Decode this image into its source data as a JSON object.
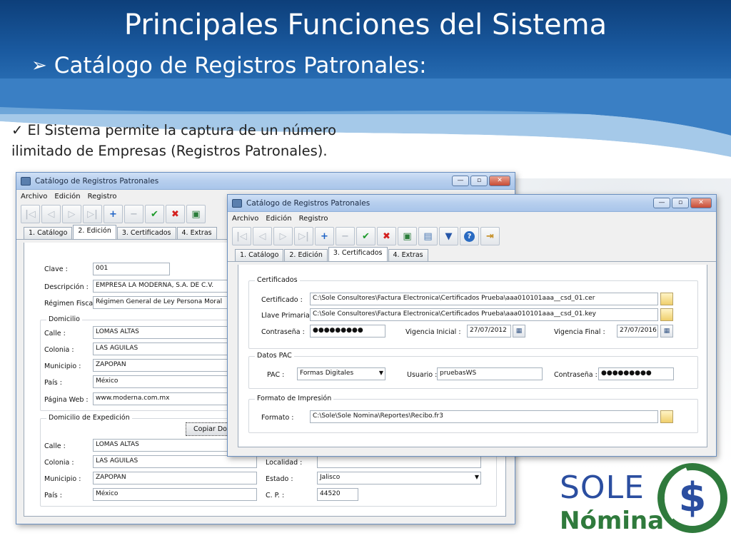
{
  "slide": {
    "title": "Principales Funciones del Sistema",
    "subtitle": "Catálogo de Registros Patronales:",
    "bullet_line1": "El Sistema  permite la captura de  un número",
    "bullet_line2": "ilimitado de Empresas (Registros Patronales)."
  },
  "back_window": {
    "title": "Catálogo de Registros Patronales",
    "menu": [
      "Archivo",
      "Edición",
      "Registro"
    ],
    "tabs": [
      "1. Catálogo",
      "2. Edición",
      "3. Certificados",
      "4. Extras"
    ],
    "active_tab": "2. Edición",
    "fields": {
      "clave_label": "Clave :",
      "clave": "001",
      "descripcion_label": "Descripción :",
      "descripcion": "EMPRESA LA MODERNA, S.A. DE C.V.",
      "regimen_label": "Régimen Fiscal :",
      "regimen": "Régimen General de Ley Persona Moral"
    },
    "domicilio": {
      "label": "Domicilio",
      "calle_label": "Calle :",
      "calle": "LOMAS ALTAS",
      "colonia_label": "Colonia :",
      "colonia": "LAS AGUILAS",
      "municipio_label": "Municipio :",
      "municipio": "ZAPOPAN",
      "pais_label": "País :",
      "pais": "México",
      "web_label": "Página Web :",
      "web": "www.moderna.com.mx"
    },
    "expedicion": {
      "label": "Domicilio de Expedición",
      "copy_button": "Copiar Dom",
      "calle_label": "Calle :",
      "calle": "LOMAS ALTAS",
      "colonia_label": "Colonia :",
      "colonia": "LAS AGUILAS",
      "municipio_label": "Municipio :",
      "municipio": "ZAPOPAN",
      "pais_label": "País :",
      "pais": "México",
      "localidad_label": "Localidad :",
      "localidad": "",
      "estado_label": "Estado :",
      "estado": "Jalisco",
      "cp_label": "C. P. :",
      "cp": "44520"
    }
  },
  "front_window": {
    "title": "Catálogo de Registros Patronales",
    "menu": [
      "Archivo",
      "Edición",
      "Registro"
    ],
    "tabs": [
      "1. Catálogo",
      "2. Edición",
      "3. Certificados",
      "4. Extras"
    ],
    "active_tab": "3. Certificados",
    "certificados": {
      "label": "Certificados",
      "certificado_label": "Certificado :",
      "certificado": "C:\\Sole Consultores\\Factura Electronica\\Certificados Prueba\\aaa010101aaa__csd_01.cer",
      "llave_label": "Llave Primaria :",
      "llave": "C:\\Sole Consultores\\Factura Electronica\\Certificados Prueba\\aaa010101aaa__csd_01.key",
      "contrasena_label": "Contraseña :",
      "contrasena": "●●●●●●●●●",
      "vig_ini_label": "Vigencia Inicial :",
      "vig_ini": "27/07/2012",
      "vig_fin_label": "Vigencia Final :",
      "vig_fin": "27/07/2016"
    },
    "pac": {
      "label": "Datos PAC",
      "pac_label": "PAC :",
      "pac": "Formas Digitales",
      "usuario_label": "Usuario :",
      "usuario": "pruebasWS",
      "contrasena_label": "Contraseña :",
      "contrasena": "●●●●●●●●●"
    },
    "impresion": {
      "label": "Formato de Impresión",
      "formato_label": "Formato :",
      "formato": "C:\\Sole\\Sole Nomina\\Reportes\\Recibo.fr3"
    }
  },
  "logo": {
    "line1": "SOLE",
    "line2": "Nómina"
  },
  "colors": {
    "header": "#1a5aa0",
    "logo_blue": "#2b4ea0",
    "logo_green": "#2f7a3c"
  }
}
